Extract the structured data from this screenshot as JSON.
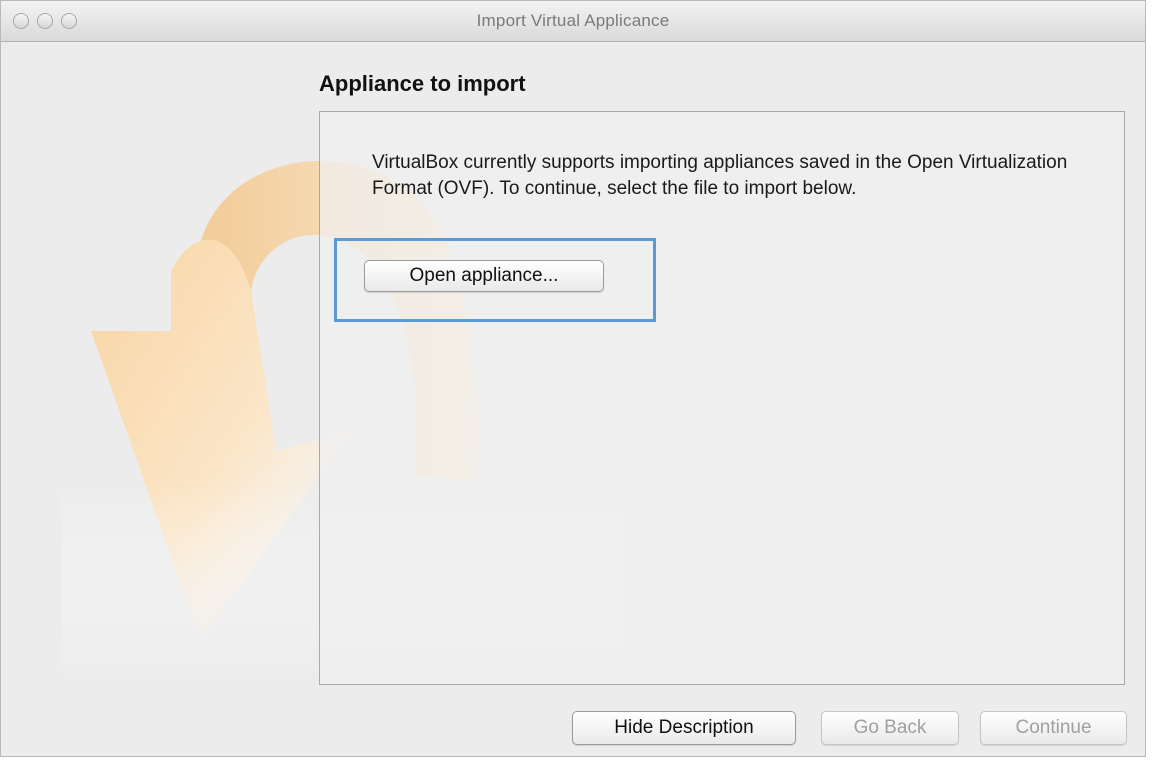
{
  "window": {
    "title": "Import Virtual Applicance"
  },
  "wizard": {
    "heading": "Appliance to import",
    "description": "VirtualBox currently supports importing appliances saved in the Open Virtualization Format (OVF). To continue, select the file to import below.",
    "open_button_label": "Open appliance..."
  },
  "footer": {
    "hide_description_label": "Hide Description",
    "go_back_label": "Go Back",
    "continue_label": "Continue"
  },
  "icons": {
    "watermark": "import-arrow-icon",
    "window_controls": [
      "close-button-icon",
      "minimize-button-icon",
      "zoom-button-icon"
    ]
  },
  "colors": {
    "highlight": "#5b9bd5",
    "window_background": "#ececec"
  }
}
